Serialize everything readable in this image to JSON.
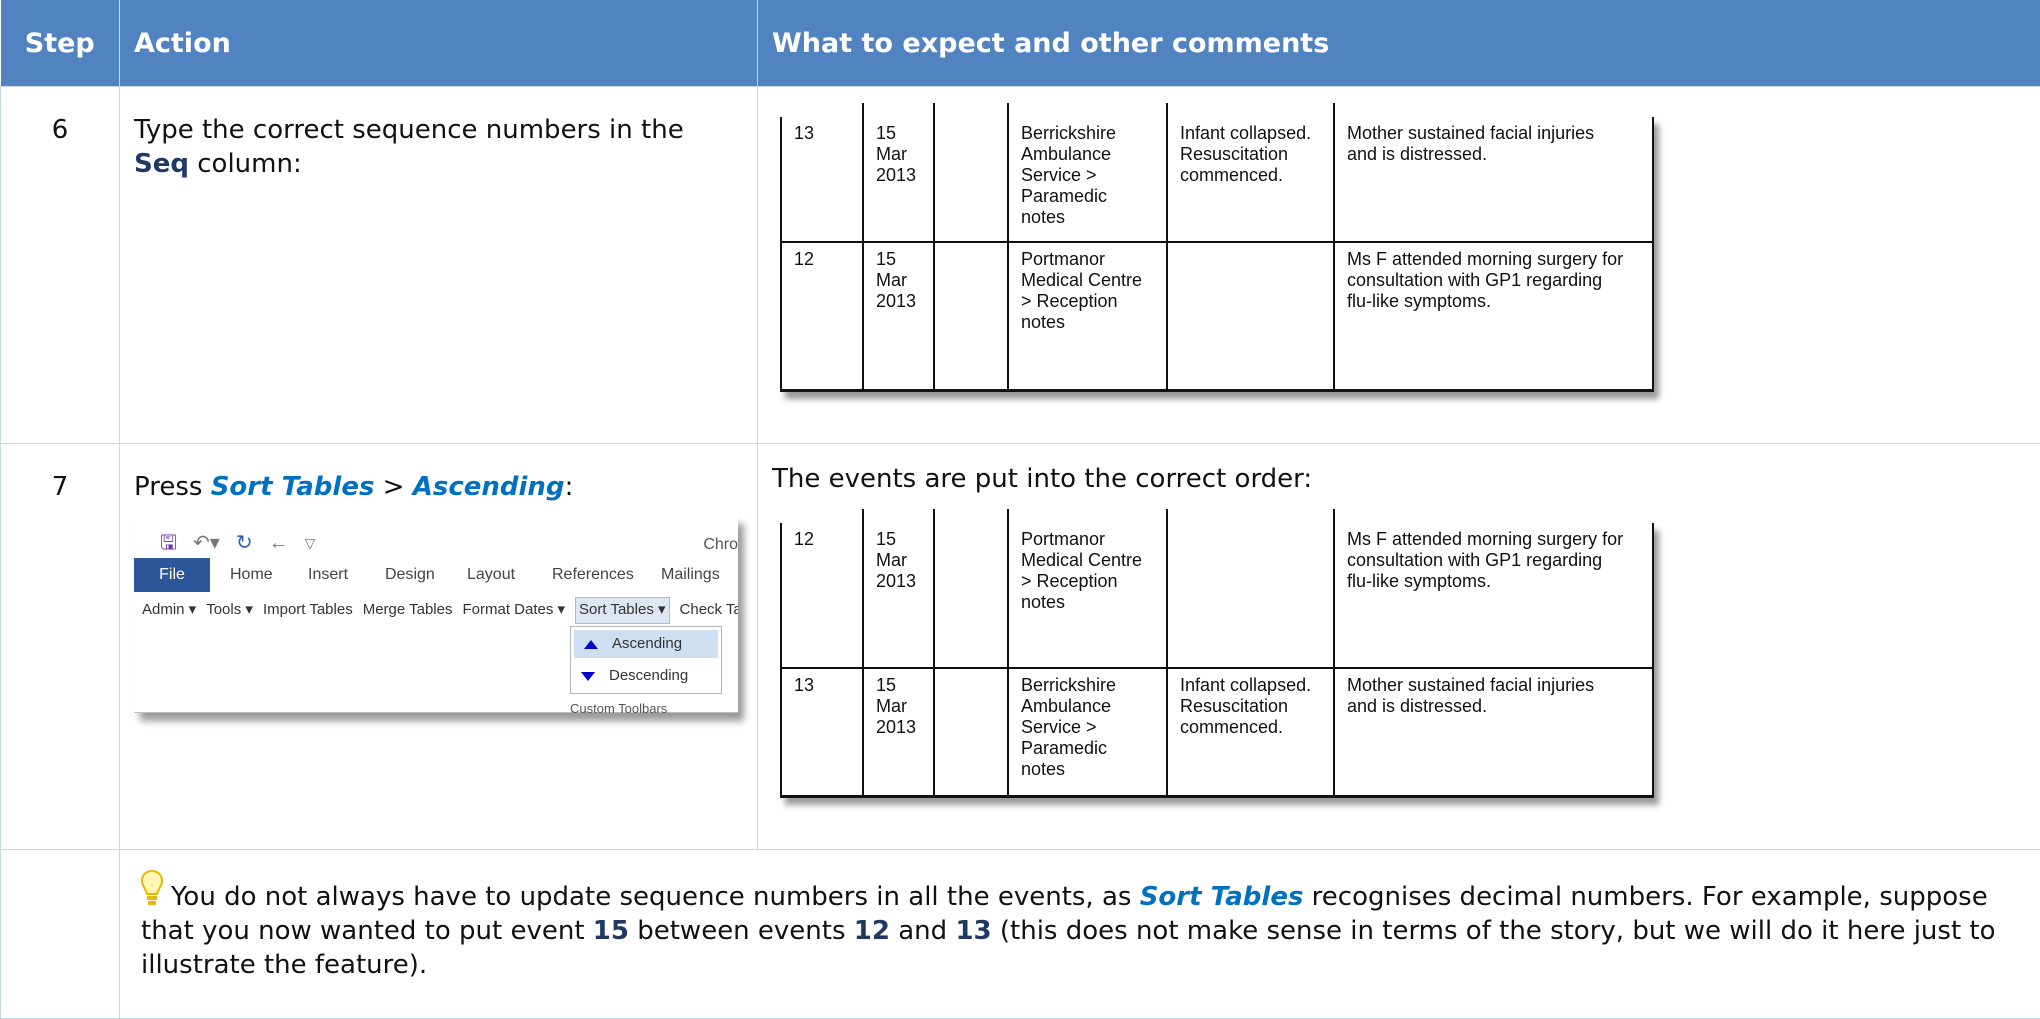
{
  "header": {
    "col_step": "Step",
    "col_action": "Action",
    "col_expect": "What to expect and other comments"
  },
  "rows": [
    {
      "step": "6",
      "action_prefix": "Type the correct sequence numbers in the ",
      "action_bold": "Seq",
      "action_suffix": " column:",
      "records": [
        {
          "seq": "13",
          "date": "15\nMar\n2013",
          "blank": "",
          "source": "Berrickshire\nAmbulance\nService >\nParamedic\nnotes",
          "event": "Infant collapsed.\nResuscitation\ncommenced.",
          "comment": "Mother sustained facial injuries\nand is distressed."
        },
        {
          "seq": "12",
          "date": "15\nMar\n2013",
          "blank": "",
          "source": "Portmanor\nMedical Centre\n> Reception\nnotes",
          "event": "",
          "comment": "Ms F attended morning surgery for\nconsultation with GP1 regarding\nflu-like symptoms."
        }
      ]
    },
    {
      "step": "7",
      "action_prefix": "Press ",
      "action_link1": "Sort Tables",
      "action_sep": " > ",
      "action_link2": "Ascending",
      "action_suffix": ":",
      "expect_text": "The events are put into the correct order:",
      "records": [
        {
          "seq": "12",
          "date": "15\nMar\n2013",
          "blank": "",
          "source": "Portmanor\nMedical Centre\n> Reception\nnotes",
          "event": "",
          "comment": "Ms F attended morning surgery for\nconsultation with GP1 regarding\nflu-like symptoms."
        },
        {
          "seq": "13",
          "date": "15\nMar\n2013",
          "blank": "",
          "source": "Berrickshire\nAmbulance\nService >\nParamedic\nnotes",
          "event": "Infant collapsed.\nResuscitation\ncommenced.",
          "comment": "Mother sustained facial injuries\nand is distressed."
        }
      ]
    }
  ],
  "ribbon": {
    "title_fragment": "Chro",
    "tabs": [
      "File",
      "Home",
      "Insert",
      "Design",
      "Layout",
      "References",
      "Mailings"
    ],
    "tools": [
      "Admin ▾",
      "Tools ▾",
      "Import Tables",
      "Merge Tables",
      "Format Dates ▾",
      "Sort Tables ▾",
      "Check Tab"
    ],
    "dropdown": [
      "Ascending",
      "Descending"
    ],
    "group_label": "Custom Toolbars"
  },
  "tip": {
    "t1": "You do not always have to update sequence numbers in all the events, as ",
    "link": "Sort Tables",
    "t2": " recognises decimal numbers. For example, suppose that you now wanted to put event ",
    "n1": "15",
    "t3": " between events ",
    "n2": "12",
    "t4": " and ",
    "n3": "13",
    "t5": " (this does not make sense in terms of the story, but we will do it here just to illustrate the feature)."
  },
  "colors": {
    "header_bg": "#5083bf",
    "link": "#0070c0",
    "emphasis": "#1f3864",
    "file_tab": "#2b579a"
  }
}
